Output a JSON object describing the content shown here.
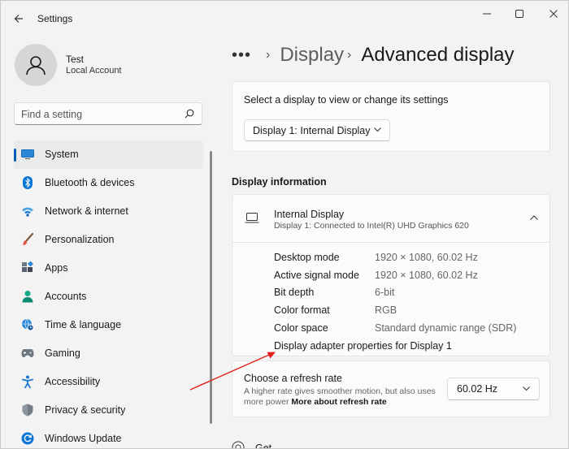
{
  "window": {
    "title": "Settings",
    "controls": [
      "minimize-icon",
      "maximize-icon",
      "close-icon"
    ]
  },
  "user": {
    "name": "Test",
    "account_type": "Local Account"
  },
  "search": {
    "placeholder": "Find a setting"
  },
  "sidebar": {
    "items": [
      {
        "label": "System",
        "icon": "system-icon",
        "active": true
      },
      {
        "label": "Bluetooth & devices",
        "icon": "bluetooth-icon"
      },
      {
        "label": "Network & internet",
        "icon": "wifi-icon"
      },
      {
        "label": "Personalization",
        "icon": "brush-icon"
      },
      {
        "label": "Apps",
        "icon": "apps-icon"
      },
      {
        "label": "Accounts",
        "icon": "accounts-icon"
      },
      {
        "label": "Time & language",
        "icon": "globe-clock-icon"
      },
      {
        "label": "Gaming",
        "icon": "gamepad-icon"
      },
      {
        "label": "Accessibility",
        "icon": "accessibility-icon"
      },
      {
        "label": "Privacy & security",
        "icon": "shield-icon"
      },
      {
        "label": "Windows Update",
        "icon": "update-icon"
      }
    ]
  },
  "breadcrumb": {
    "more": "•••",
    "parent": "Display",
    "current": "Advanced display"
  },
  "display_select": {
    "prompt": "Select a display to view or change its settings",
    "selected": "Display 1: Internal Display"
  },
  "display_info": {
    "section_title": "Display information",
    "title": "Internal Display",
    "subtitle": "Display 1: Connected to Intel(R) UHD Graphics 620",
    "properties": [
      {
        "name": "Desktop mode",
        "value": "1920 × 1080, 60.02 Hz"
      },
      {
        "name": "Active signal mode",
        "value": "1920 × 1080, 60.02 Hz"
      },
      {
        "name": "Bit depth",
        "value": "6-bit"
      },
      {
        "name": "Color format",
        "value": "RGB"
      },
      {
        "name": "Color space",
        "value": "Standard dynamic range (SDR)"
      }
    ],
    "adapter_link": "Display adapter properties for Display 1"
  },
  "refresh_rate": {
    "title": "Choose a refresh rate",
    "description": "A higher rate gives smoother motion, but also uses more power",
    "link": "More about refresh rate",
    "selected": "60.02 Hz"
  },
  "help": {
    "label": "Get help"
  },
  "colors": {
    "accent": "#005fb8",
    "annotation_arrow": "#e0201b"
  }
}
